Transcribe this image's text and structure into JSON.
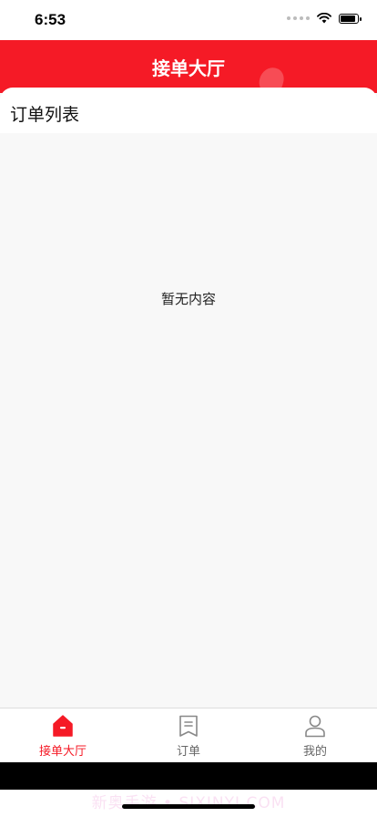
{
  "status_bar": {
    "time": "6:53"
  },
  "header": {
    "title": "接单大厅",
    "background_color": "#f51a26"
  },
  "section": {
    "title": "订单列表"
  },
  "empty_state": {
    "message": "暂无内容"
  },
  "tab_bar": {
    "active_color": "#f51a26",
    "tabs": [
      {
        "label": "接单大厅",
        "icon": "hall-icon",
        "active": true
      },
      {
        "label": "订单",
        "icon": "order-icon",
        "active": false
      },
      {
        "label": "我的",
        "icon": "profile-icon",
        "active": false
      }
    ]
  },
  "watermark": {
    "text": "新奥手游 • SIXINYI.COM"
  }
}
